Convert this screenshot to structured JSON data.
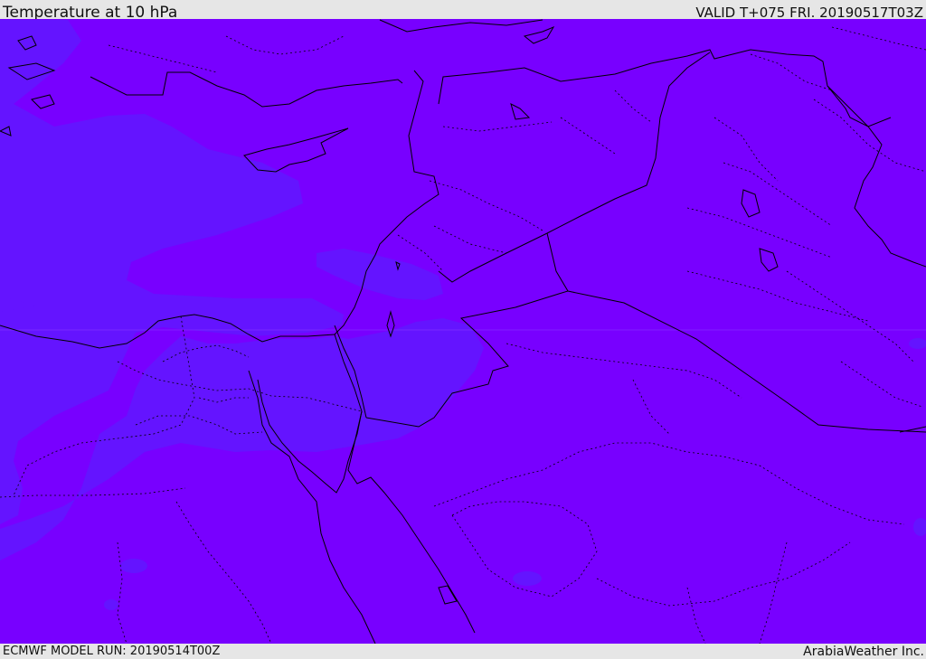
{
  "header": {
    "title": "Temperature at 10 hPa",
    "valid": "VALID T+075 FRI. 20190517T03Z"
  },
  "footer": {
    "model_run": "ECMWF MODEL RUN: 20190514T00Z",
    "credit": "ArabiaWeather Inc."
  },
  "colors": {
    "fill_main": "#7800ff",
    "fill_cool": "#6414ff",
    "border": "#000000",
    "bar_background": "#e6e6e6"
  }
}
